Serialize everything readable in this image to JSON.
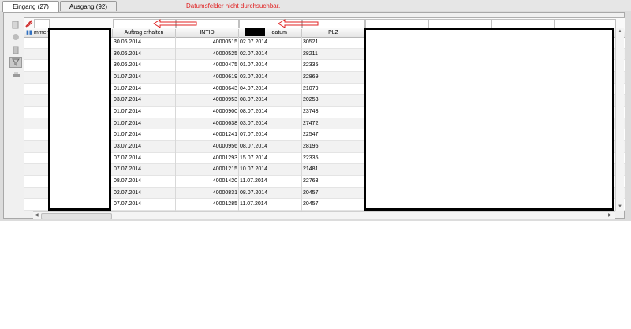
{
  "tabs": [
    {
      "label": "Eingang (27)"
    },
    {
      "label": "Ausgang (92)"
    }
  ],
  "annotation": "Datumsfelder nicht durchsuchbar.",
  "columns": {
    "c0": "mmer",
    "c1": "",
    "c2": "Auftrag erhalten",
    "c3": "INTID",
    "c4": "datum",
    "c5": "PLZ"
  },
  "rows": [
    {
      "auftrag": "30.06.2014",
      "intid": "40000515",
      "datum": "02.07.2014",
      "plz": "30521"
    },
    {
      "auftrag": "30.06.2014",
      "intid": "40000525",
      "datum": "02.07.2014",
      "plz": "28211"
    },
    {
      "auftrag": "30.06.2014",
      "intid": "40000475",
      "datum": "01.07.2014",
      "plz": "22335"
    },
    {
      "auftrag": "01.07.2014",
      "intid": "40000619",
      "datum": "03.07.2014",
      "plz": "22869"
    },
    {
      "auftrag": "01.07.2014",
      "intid": "40000643",
      "datum": "04.07.2014",
      "plz": "21079"
    },
    {
      "auftrag": "03.07.2014",
      "intid": "40000953",
      "datum": "08.07.2014",
      "plz": "20253"
    },
    {
      "auftrag": "01.07.2014",
      "intid": "40000900",
      "datum": "08.07.2014",
      "plz": "23743"
    },
    {
      "auftrag": "01.07.2014",
      "intid": "40000638",
      "datum": "03.07.2014",
      "plz": "27472"
    },
    {
      "auftrag": "01.07.2014",
      "intid": "40001241",
      "datum": "07.07.2014",
      "plz": "22547"
    },
    {
      "auftrag": "03.07.2014",
      "intid": "40000956",
      "datum": "08.07.2014",
      "plz": "28195"
    },
    {
      "auftrag": "07.07.2014",
      "intid": "40001293",
      "datum": "15.07.2014",
      "plz": "22335"
    },
    {
      "auftrag": "07.07.2014",
      "intid": "40001215",
      "datum": "10.07.2014",
      "plz": "21481"
    },
    {
      "auftrag": "08.07.2014",
      "intid": "40001420",
      "datum": "11.07.2014",
      "plz": "22763"
    },
    {
      "auftrag": "02.07.2014",
      "intid": "40000831",
      "datum": "08.07.2014",
      "plz": "20457"
    },
    {
      "auftrag": "07.07.2014",
      "intid": "40001285",
      "datum": "11.07.2014",
      "plz": "20457"
    }
  ],
  "colors": {
    "annotation": "#e02020",
    "redaction_border": "#000000"
  },
  "icons": [
    "clear-filter-icon",
    "column-chooser-icon",
    "copy-icon",
    "settings-icon",
    "export-icon",
    "filter-icon",
    "print-icon"
  ]
}
